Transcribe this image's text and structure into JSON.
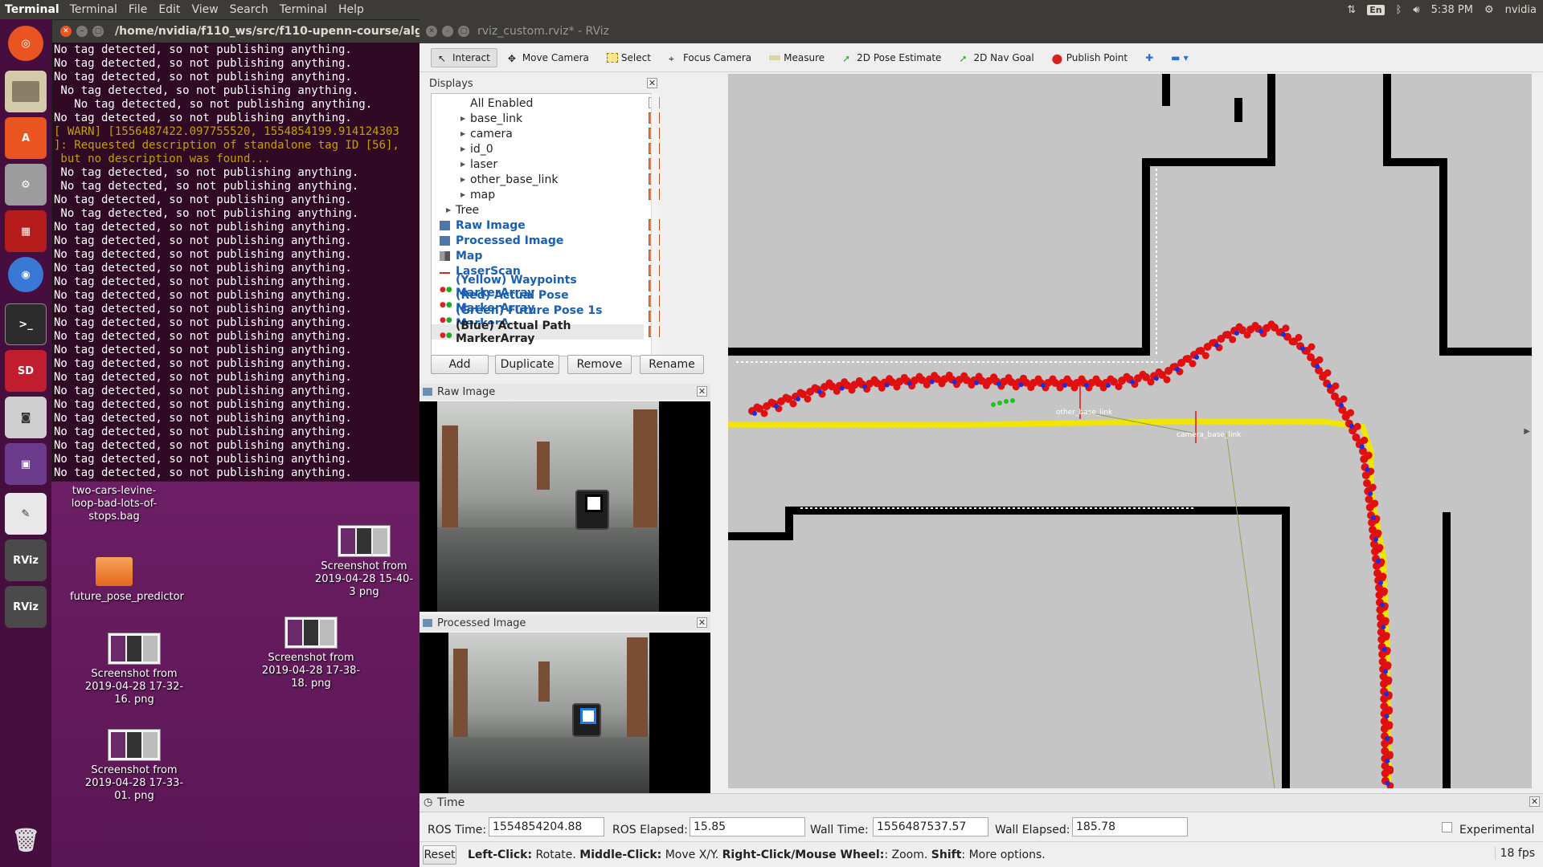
{
  "topbar": {
    "app": "Terminal",
    "menus": [
      "Terminal",
      "File",
      "Edit",
      "View",
      "Search",
      "Terminal",
      "Help"
    ],
    "lang": "En",
    "clock": "5:38 PM",
    "user": "nvidia"
  },
  "launcher": {
    "items": [
      "Ubuntu",
      "Files",
      "Software",
      "Settings",
      "Workspace",
      "Chromium",
      "Terminal",
      "SD Card",
      "Camera",
      "Screenshot",
      "Text Editor",
      "RViz",
      "RViz",
      "Trash"
    ],
    "rviz_label": "RViz",
    "sd_label": "SD"
  },
  "desktop": {
    "icons": [
      {
        "label": "two-cars-levine-loop-bad-lots-of-stops.bag"
      },
      {
        "label": "future_pose_predictor"
      },
      {
        "label": "Screenshot from 2019-04-28 15-40-3 png"
      },
      {
        "label": "Screenshot from 2019-04-28 17-38-18. png"
      },
      {
        "label": "Screenshot from 2019-04-28 17-32-16. png"
      },
      {
        "label": "Screenshot from 2019-04-28 17-33-01. png"
      }
    ]
  },
  "terminal": {
    "title": "/home/nvidia/f110_ws/src/f110-upenn-course/algorit",
    "lines": [
      "No tag detected, so not publishing anything.",
      "No tag detected, so not publishing anything.",
      "No tag detected, so not publishing anything.",
      " No tag detected, so not publishing anything.",
      "   No tag detected, so not publishing anything.",
      "No tag detected, so not publishing anything.",
      "[ WARN] [1556487422.097755520, 1554854199.914124303",
      "]: Requested description of standalone tag ID [56],",
      " but no description was found...",
      " No tag detected, so not publishing anything.",
      " No tag detected, so not publishing anything.",
      "No tag detected, so not publishing anything.",
      " No tag detected, so not publishing anything.",
      "No tag detected, so not publishing anything.",
      "No tag detected, so not publishing anything.",
      "No tag detected, so not publishing anything.",
      "No tag detected, so not publishing anything.",
      "No tag detected, so not publishing anything.",
      "No tag detected, so not publishing anything.",
      "No tag detected, so not publishing anything.",
      "No tag detected, so not publishing anything.",
      "No tag detected, so not publishing anything.",
      "No tag detected, so not publishing anything.",
      "No tag detected, so not publishing anything.",
      "No tag detected, so not publishing anything.",
      "No tag detected, so not publishing anything.",
      "No tag detected, so not publishing anything.",
      "No tag detected, so not publishing anything.",
      "No tag detected, so not publishing anything.",
      "No tag detected, so not publishing anything.",
      "No tag detected, so not publishing anything.",
      "No tag detected, so not publishing anything.",
      "No tag detected, so not publishing anything."
    ]
  },
  "rviz": {
    "title": "rviz_custom.rviz* - RViz",
    "tools": [
      "Interact",
      "Move Camera",
      "Select",
      "Focus Camera",
      "Measure",
      "2D Pose Estimate",
      "2D Nav Goal",
      "Publish Point"
    ],
    "displays_title": "Displays",
    "displays": [
      {
        "label": "All Enabled",
        "checked": false
      },
      {
        "label": "base_link",
        "checked": true
      },
      {
        "label": "camera",
        "checked": true
      },
      {
        "label": "id_0",
        "checked": true
      },
      {
        "label": "laser",
        "checked": true
      },
      {
        "label": "other_base_link",
        "checked": true
      },
      {
        "label": "map",
        "checked": true
      },
      {
        "label": "Tree",
        "checked": null
      },
      {
        "label": "Raw Image",
        "checked": true
      },
      {
        "label": "Processed Image",
        "checked": true
      },
      {
        "label": "Map",
        "checked": true
      },
      {
        "label": "LaserScan",
        "checked": true
      },
      {
        "label": "(Yellow) Waypoints MarkerArray",
        "checked": true
      },
      {
        "label": "(Red) Actual Pose MarkerArray",
        "checked": true
      },
      {
        "label": "(Green) Future Pose 1s MarkerA...",
        "checked": true
      },
      {
        "label": "(Blue) Actual Path MarkerArray",
        "checked": true
      }
    ],
    "buttons": {
      "add": "Add",
      "duplicate": "Duplicate",
      "remove": "Remove",
      "rename": "Rename"
    },
    "raw_image_title": "Raw Image",
    "processed_image_title": "Processed Image",
    "map_labels": {
      "other": "other_base_link",
      "self": "camera_base_link"
    },
    "colors": {
      "waypoints": "#f2e600",
      "actual_pose": "#e01010",
      "future_pose": "#22c022",
      "actual_path": "#1a2ee0"
    },
    "time": {
      "title": "Time",
      "ros_time_label": "ROS Time:",
      "ros_time": "1554854204.88",
      "ros_elapsed_label": "ROS Elapsed:",
      "ros_elapsed": "15.85",
      "wall_time_label": "Wall Time:",
      "wall_time": "1556487537.57",
      "wall_elapsed_label": "Wall Elapsed:",
      "wall_elapsed": "185.78",
      "experimental": "Experimental"
    },
    "status": {
      "reset": "Reset",
      "left_click": "Left-Click:",
      "left_click_desc": "Rotate.",
      "middle_click": "Middle-Click:",
      "middle_click_desc": "Move X/Y.",
      "right_click": "Right-Click/Mouse Wheel:",
      "right_click_desc": ": Zoom.",
      "shift": "Shift",
      "shift_desc": ": More options.",
      "fps": "18 fps"
    }
  }
}
